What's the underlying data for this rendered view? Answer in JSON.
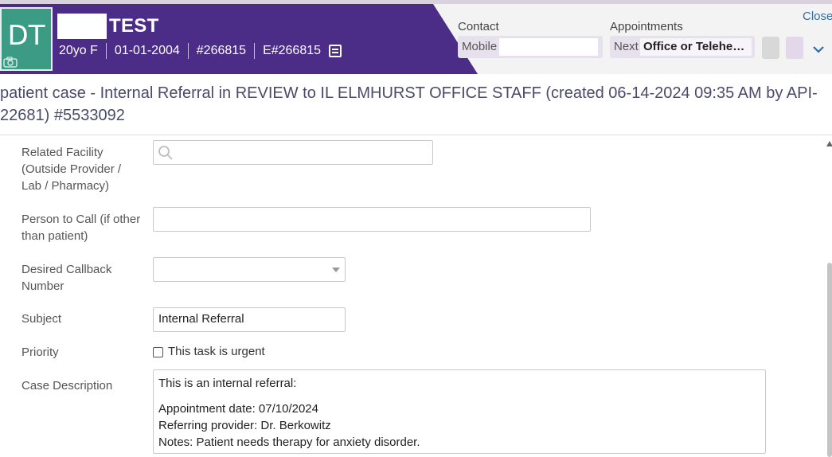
{
  "header": {
    "avatar_initials": "DT",
    "patient_name": "TEST",
    "age_sex": "20yo F",
    "dob": "01-01-2004",
    "patient_id": "#266815",
    "enterprise_id": "E#266815",
    "contact_label": "Contact",
    "mobile_label": "Mobile",
    "appointments_label": "Appointments",
    "next_label": "Next",
    "next_appointment": "Office or Teleheal...",
    "close_label": "Close",
    "colors": {
      "banner": "#4b2c86",
      "avatar": "#3b9b84",
      "link": "#2f6ea6"
    }
  },
  "case": {
    "title": "patient case - Internal Referral in REVIEW to IL ELMHURST OFFICE STAFF (created 06-14-2024 09:35 AM by API-22681) #5533092"
  },
  "form": {
    "related_facility_label": "Related Facility (Outside Provider / Lab / Pharmacy)",
    "person_to_call_label": "Person to Call (if other than patient)",
    "callback_label": "Desired Callback Number",
    "subject_label": "Subject",
    "subject_value": "Internal Referral",
    "priority_label": "Priority",
    "urgent_label": "This task is urgent",
    "description_label": "Case Description",
    "description_lines": [
      "This is an internal referral:",
      "Appointment date: 07/10/2024",
      "Referring provider: Dr. Berkowitz",
      "Notes: Patient needs therapy for anxiety disorder."
    ]
  }
}
